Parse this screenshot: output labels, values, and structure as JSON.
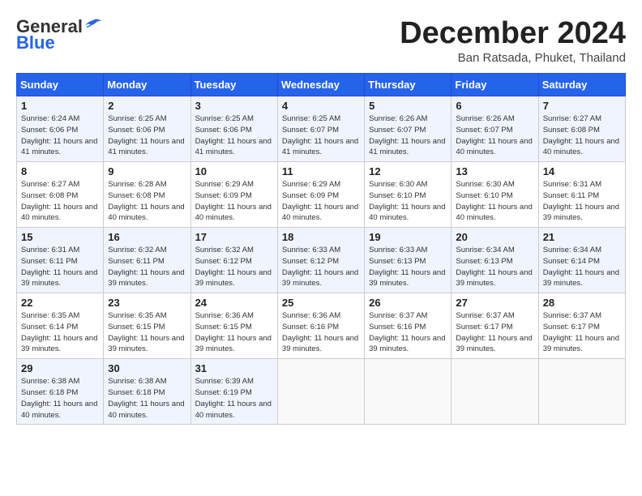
{
  "header": {
    "logo_general": "General",
    "logo_blue": "Blue",
    "month_title": "December 2024",
    "location": "Ban Ratsada, Phuket, Thailand"
  },
  "weekdays": [
    "Sunday",
    "Monday",
    "Tuesday",
    "Wednesday",
    "Thursday",
    "Friday",
    "Saturday"
  ],
  "weeks": [
    [
      {
        "day": "1",
        "info": "Sunrise: 6:24 AM\nSunset: 6:06 PM\nDaylight: 11 hours and 41 minutes."
      },
      {
        "day": "2",
        "info": "Sunrise: 6:25 AM\nSunset: 6:06 PM\nDaylight: 11 hours and 41 minutes."
      },
      {
        "day": "3",
        "info": "Sunrise: 6:25 AM\nSunset: 6:06 PM\nDaylight: 11 hours and 41 minutes."
      },
      {
        "day": "4",
        "info": "Sunrise: 6:25 AM\nSunset: 6:07 PM\nDaylight: 11 hours and 41 minutes."
      },
      {
        "day": "5",
        "info": "Sunrise: 6:26 AM\nSunset: 6:07 PM\nDaylight: 11 hours and 41 minutes."
      },
      {
        "day": "6",
        "info": "Sunrise: 6:26 AM\nSunset: 6:07 PM\nDaylight: 11 hours and 40 minutes."
      },
      {
        "day": "7",
        "info": "Sunrise: 6:27 AM\nSunset: 6:08 PM\nDaylight: 11 hours and 40 minutes."
      }
    ],
    [
      {
        "day": "8",
        "info": "Sunrise: 6:27 AM\nSunset: 6:08 PM\nDaylight: 11 hours and 40 minutes."
      },
      {
        "day": "9",
        "info": "Sunrise: 6:28 AM\nSunset: 6:08 PM\nDaylight: 11 hours and 40 minutes."
      },
      {
        "day": "10",
        "info": "Sunrise: 6:29 AM\nSunset: 6:09 PM\nDaylight: 11 hours and 40 minutes."
      },
      {
        "day": "11",
        "info": "Sunrise: 6:29 AM\nSunset: 6:09 PM\nDaylight: 11 hours and 40 minutes."
      },
      {
        "day": "12",
        "info": "Sunrise: 6:30 AM\nSunset: 6:10 PM\nDaylight: 11 hours and 40 minutes."
      },
      {
        "day": "13",
        "info": "Sunrise: 6:30 AM\nSunset: 6:10 PM\nDaylight: 11 hours and 40 minutes."
      },
      {
        "day": "14",
        "info": "Sunrise: 6:31 AM\nSunset: 6:11 PM\nDaylight: 11 hours and 39 minutes."
      }
    ],
    [
      {
        "day": "15",
        "info": "Sunrise: 6:31 AM\nSunset: 6:11 PM\nDaylight: 11 hours and 39 minutes."
      },
      {
        "day": "16",
        "info": "Sunrise: 6:32 AM\nSunset: 6:11 PM\nDaylight: 11 hours and 39 minutes."
      },
      {
        "day": "17",
        "info": "Sunrise: 6:32 AM\nSunset: 6:12 PM\nDaylight: 11 hours and 39 minutes."
      },
      {
        "day": "18",
        "info": "Sunrise: 6:33 AM\nSunset: 6:12 PM\nDaylight: 11 hours and 39 minutes."
      },
      {
        "day": "19",
        "info": "Sunrise: 6:33 AM\nSunset: 6:13 PM\nDaylight: 11 hours and 39 minutes."
      },
      {
        "day": "20",
        "info": "Sunrise: 6:34 AM\nSunset: 6:13 PM\nDaylight: 11 hours and 39 minutes."
      },
      {
        "day": "21",
        "info": "Sunrise: 6:34 AM\nSunset: 6:14 PM\nDaylight: 11 hours and 39 minutes."
      }
    ],
    [
      {
        "day": "22",
        "info": "Sunrise: 6:35 AM\nSunset: 6:14 PM\nDaylight: 11 hours and 39 minutes."
      },
      {
        "day": "23",
        "info": "Sunrise: 6:35 AM\nSunset: 6:15 PM\nDaylight: 11 hours and 39 minutes."
      },
      {
        "day": "24",
        "info": "Sunrise: 6:36 AM\nSunset: 6:15 PM\nDaylight: 11 hours and 39 minutes."
      },
      {
        "day": "25",
        "info": "Sunrise: 6:36 AM\nSunset: 6:16 PM\nDaylight: 11 hours and 39 minutes."
      },
      {
        "day": "26",
        "info": "Sunrise: 6:37 AM\nSunset: 6:16 PM\nDaylight: 11 hours and 39 minutes."
      },
      {
        "day": "27",
        "info": "Sunrise: 6:37 AM\nSunset: 6:17 PM\nDaylight: 11 hours and 39 minutes."
      },
      {
        "day": "28",
        "info": "Sunrise: 6:37 AM\nSunset: 6:17 PM\nDaylight: 11 hours and 39 minutes."
      }
    ],
    [
      {
        "day": "29",
        "info": "Sunrise: 6:38 AM\nSunset: 6:18 PM\nDaylight: 11 hours and 40 minutes."
      },
      {
        "day": "30",
        "info": "Sunrise: 6:38 AM\nSunset: 6:18 PM\nDaylight: 11 hours and 40 minutes."
      },
      {
        "day": "31",
        "info": "Sunrise: 6:39 AM\nSunset: 6:19 PM\nDaylight: 11 hours and 40 minutes."
      },
      {
        "day": "",
        "info": ""
      },
      {
        "day": "",
        "info": ""
      },
      {
        "day": "",
        "info": ""
      },
      {
        "day": "",
        "info": ""
      }
    ]
  ]
}
